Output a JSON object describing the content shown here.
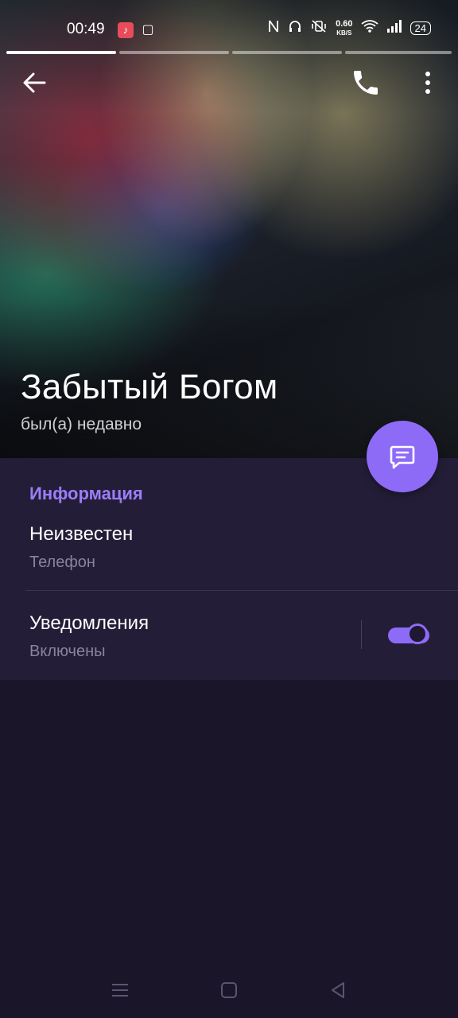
{
  "status_bar": {
    "time": "00:49",
    "net_speed_value": "0.60",
    "net_speed_unit": "KB/S",
    "battery": "24"
  },
  "profile": {
    "name": "Забытый Богом",
    "last_seen": "был(а) недавно"
  },
  "info": {
    "section_title": "Информация",
    "phone_value": "Неизвестен",
    "phone_label": "Телефон",
    "notifications_title": "Уведомления",
    "notifications_state": "Включены",
    "notifications_enabled": true
  },
  "icons": {
    "back": "arrow-left-icon",
    "call": "phone-icon",
    "more": "more-vertical-icon",
    "fab": "message-icon"
  },
  "colors": {
    "accent": "#8d6bf7",
    "card": "#241d38",
    "background": "#1a1528"
  }
}
